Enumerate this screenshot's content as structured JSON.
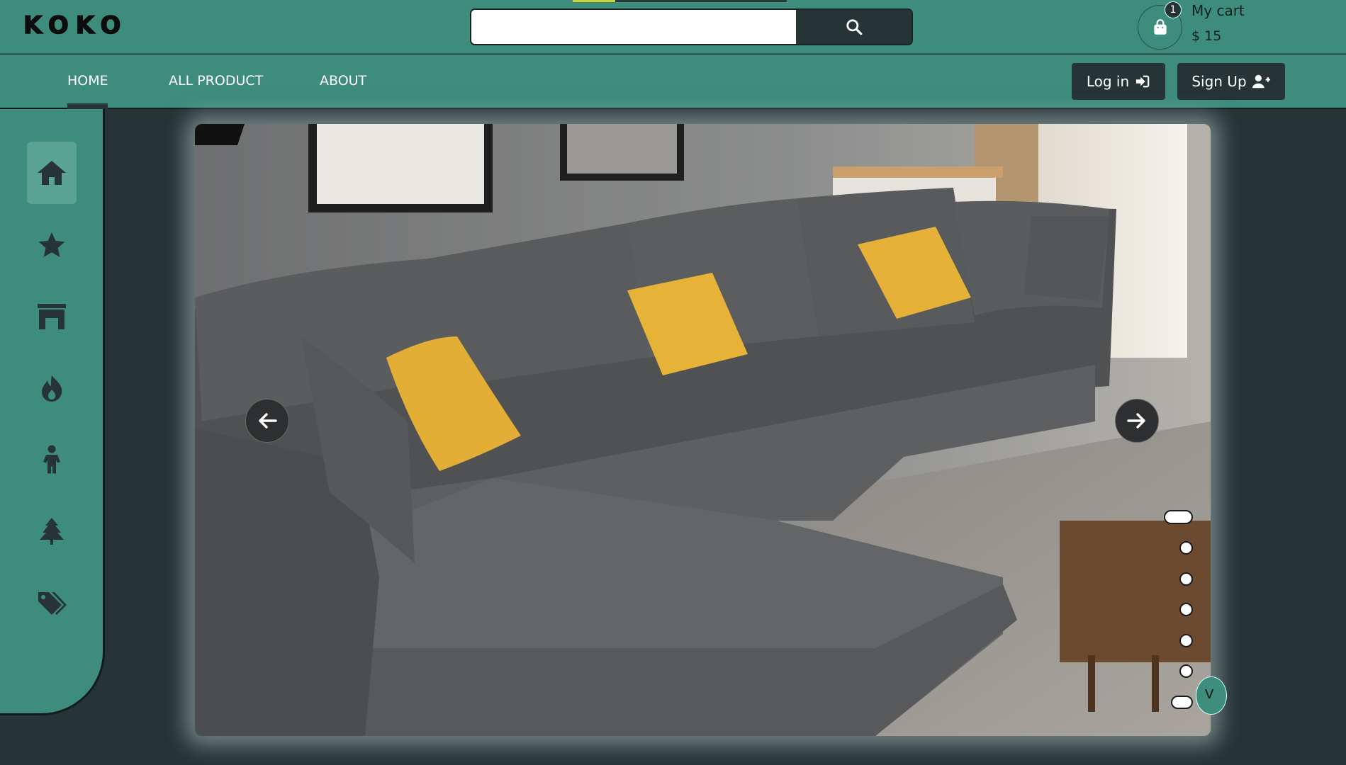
{
  "brand": {
    "logo": "KOKO"
  },
  "search": {
    "placeholder": "",
    "value": ""
  },
  "cart": {
    "badge_count": "1",
    "title": "My cart",
    "amount": "$ 15"
  },
  "nav": {
    "links": [
      "HOME",
      "ALL PRODUCT",
      "ABOUT"
    ],
    "active": "HOME"
  },
  "auth": {
    "login_label": "Log in",
    "signup_label": "Sign Up"
  },
  "sidebar": {
    "items": [
      {
        "icon": "home-icon",
        "active": true
      },
      {
        "icon": "star-icon"
      },
      {
        "icon": "furniture-icon"
      },
      {
        "icon": "fire-icon"
      },
      {
        "icon": "child-icon"
      },
      {
        "icon": "tree-icon"
      },
      {
        "icon": "tags-icon"
      }
    ]
  },
  "slider": {
    "slide_count": 7,
    "active_index": 0
  },
  "peek": {
    "label": "V"
  },
  "colors": {
    "header_bg": "#3d8c7c",
    "page_bg": "#263436",
    "dark_button": "#263436",
    "accent_line": "#c8d23a"
  }
}
